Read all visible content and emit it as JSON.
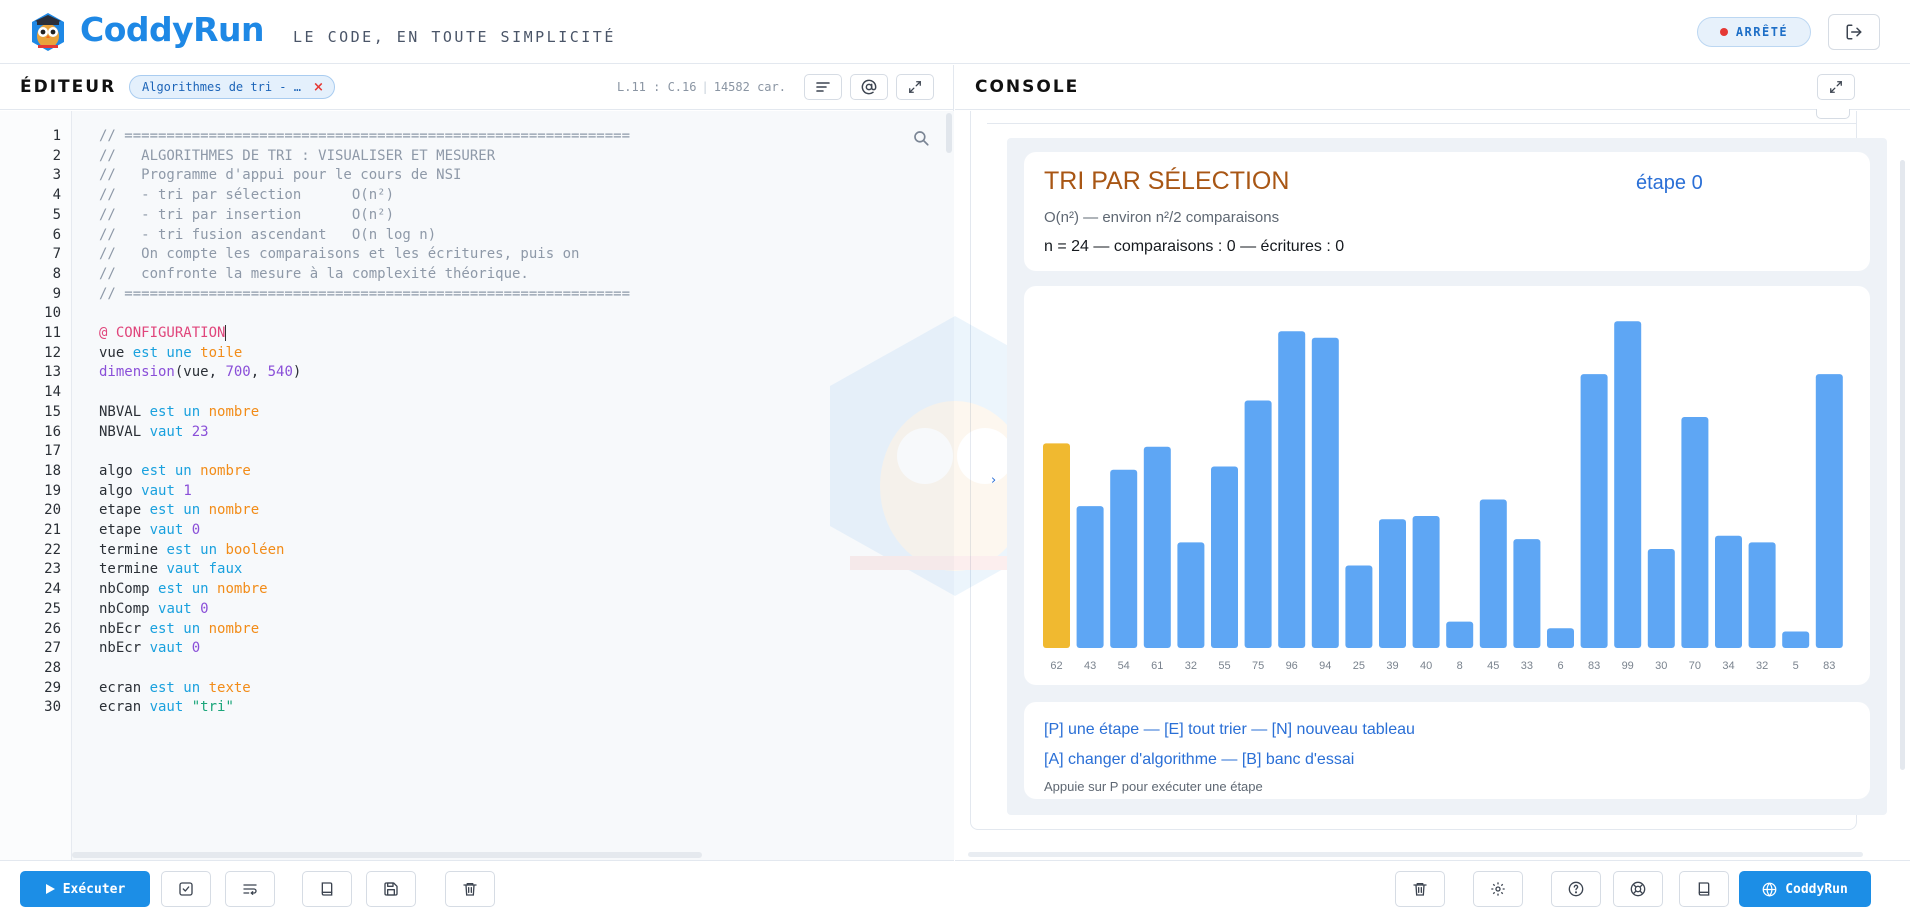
{
  "header": {
    "brand": "CoddyRun",
    "tagline": "LE CODE, EN TOUTE SIMPLICITÉ",
    "status": "ARRÊTÉ",
    "status_color": "#e53935",
    "logout_icon": "logout-icon"
  },
  "editor": {
    "title": "ÉDITEUR",
    "file_tab": "Algorithmes de tri - …",
    "file_tab_close": "×",
    "cursor_pos": "L.11 : C.16",
    "char_count": "14582 car.",
    "tools": [
      "format-icon",
      "at-icon",
      "expand-icon"
    ],
    "line_numbers": [
      "1",
      "2",
      "3",
      "4",
      "5",
      "6",
      "7",
      "8",
      "9",
      "10",
      "11",
      "12",
      "13",
      "14",
      "15",
      "16",
      "17",
      "18",
      "19",
      "20",
      "21",
      "22",
      "23",
      "24",
      "25",
      "26",
      "27",
      "28",
      "29",
      "30"
    ],
    "lines": [
      [
        {
          "t": "// ============================================================",
          "c": "comment"
        }
      ],
      [
        {
          "t": "//   ALGORITHMES DE TRI : VISUALISER ET MESURER",
          "c": "comment"
        }
      ],
      [
        {
          "t": "//   Programme d'appui pour le cours de NSI",
          "c": "comment"
        }
      ],
      [
        {
          "t": "//   - tri par sélection      O(n²)",
          "c": "comment"
        }
      ],
      [
        {
          "t": "//   - tri par insertion      O(n²)",
          "c": "comment"
        }
      ],
      [
        {
          "t": "//   - tri fusion ascendant   O(n log n)",
          "c": "comment"
        }
      ],
      [
        {
          "t": "//   On compte les comparaisons et les écritures, puis on",
          "c": "comment"
        }
      ],
      [
        {
          "t": "//   confronte la mesure à la complexité théorique.",
          "c": "comment"
        }
      ],
      [
        {
          "t": "// ============================================================",
          "c": "comment"
        }
      ],
      [],
      [
        {
          "t": "@ CONFIGURATION",
          "c": "dir"
        }
      ],
      [
        {
          "t": "vue ",
          "c": ""
        },
        {
          "t": "est une ",
          "c": "kw"
        },
        {
          "t": "toile",
          "c": "type"
        }
      ],
      [
        {
          "t": "dimension",
          "c": "fn"
        },
        {
          "t": "(vue, ",
          "c": ""
        },
        {
          "t": "700",
          "c": "num"
        },
        {
          "t": ", ",
          "c": ""
        },
        {
          "t": "540",
          "c": "num"
        },
        {
          "t": ")",
          "c": ""
        }
      ],
      [],
      [
        {
          "t": "NBVAL ",
          "c": ""
        },
        {
          "t": "est un ",
          "c": "kw"
        },
        {
          "t": "nombre",
          "c": "type"
        }
      ],
      [
        {
          "t": "NBVAL ",
          "c": ""
        },
        {
          "t": "vaut ",
          "c": "kw"
        },
        {
          "t": "23",
          "c": "num"
        }
      ],
      [],
      [
        {
          "t": "algo ",
          "c": ""
        },
        {
          "t": "est un ",
          "c": "kw"
        },
        {
          "t": "nombre",
          "c": "type"
        }
      ],
      [
        {
          "t": "algo ",
          "c": ""
        },
        {
          "t": "vaut ",
          "c": "kw"
        },
        {
          "t": "1",
          "c": "num"
        }
      ],
      [
        {
          "t": "etape ",
          "c": ""
        },
        {
          "t": "est un ",
          "c": "kw"
        },
        {
          "t": "nombre",
          "c": "type"
        }
      ],
      [
        {
          "t": "etape ",
          "c": ""
        },
        {
          "t": "vaut ",
          "c": "kw"
        },
        {
          "t": "0",
          "c": "num"
        }
      ],
      [
        {
          "t": "termine ",
          "c": ""
        },
        {
          "t": "est un ",
          "c": "kw"
        },
        {
          "t": "booléen",
          "c": "type"
        }
      ],
      [
        {
          "t": "termine ",
          "c": ""
        },
        {
          "t": "vaut ",
          "c": "kw"
        },
        {
          "t": "faux",
          "c": "kw"
        }
      ],
      [
        {
          "t": "nbComp ",
          "c": ""
        },
        {
          "t": "est un ",
          "c": "kw"
        },
        {
          "t": "nombre",
          "c": "type"
        }
      ],
      [
        {
          "t": "nbComp ",
          "c": ""
        },
        {
          "t": "vaut ",
          "c": "kw"
        },
        {
          "t": "0",
          "c": "num"
        }
      ],
      [
        {
          "t": "nbEcr ",
          "c": ""
        },
        {
          "t": "est un ",
          "c": "kw"
        },
        {
          "t": "nombre",
          "c": "type"
        }
      ],
      [
        {
          "t": "nbEcr ",
          "c": ""
        },
        {
          "t": "vaut ",
          "c": "kw"
        },
        {
          "t": "0",
          "c": "num"
        }
      ],
      [],
      [
        {
          "t": "ecran ",
          "c": ""
        },
        {
          "t": "est un ",
          "c": "kw"
        },
        {
          "t": "texte",
          "c": "type"
        }
      ],
      [
        {
          "t": "ecran ",
          "c": ""
        },
        {
          "t": "vaut ",
          "c": "kw"
        },
        {
          "t": "\"tri\"",
          "c": "str"
        }
      ]
    ],
    "run_label": "Exécuter",
    "footer_tools": [
      "check-icon",
      "wrap-icon",
      "book-icon",
      "save-icon",
      "trash-icon"
    ]
  },
  "console": {
    "title": "CONSOLE",
    "algo_title": "TRI PAR SÉLECTION",
    "step": "étape 0",
    "complexity": "O(n²) — environ n²/2 comparaisons",
    "stats": "n = 24 — comparaisons : 0 — écritures : 0",
    "help_1": "[P] une étape — [E] tout trier — [N] nouveau tableau",
    "help_2": "[A] changer d'algorithme — [B] banc d'essai",
    "hint": "Appuie sur P pour exécuter une étape",
    "expander": "›",
    "footer_tools": [
      "trash-icon",
      "gear-icon",
      "help-icon",
      "lifebuoy-icon",
      "book-icon"
    ],
    "brand_button": "CoddyRun"
  },
  "chart_data": {
    "type": "bar",
    "categories": [
      "62",
      "43",
      "54",
      "61",
      "32",
      "55",
      "75",
      "96",
      "94",
      "25",
      "39",
      "40",
      "8",
      "45",
      "33",
      "6",
      "83",
      "99",
      "30",
      "70",
      "34",
      "32",
      "5",
      "83"
    ],
    "values": [
      62,
      43,
      54,
      61,
      32,
      55,
      75,
      96,
      94,
      25,
      39,
      40,
      8,
      45,
      33,
      6,
      83,
      99,
      30,
      70,
      34,
      32,
      5,
      83
    ],
    "highlight_index": 0,
    "highlight_color": "#f0b930",
    "bar_color": "#5ea6f4",
    "ylim": [
      0,
      100
    ]
  }
}
